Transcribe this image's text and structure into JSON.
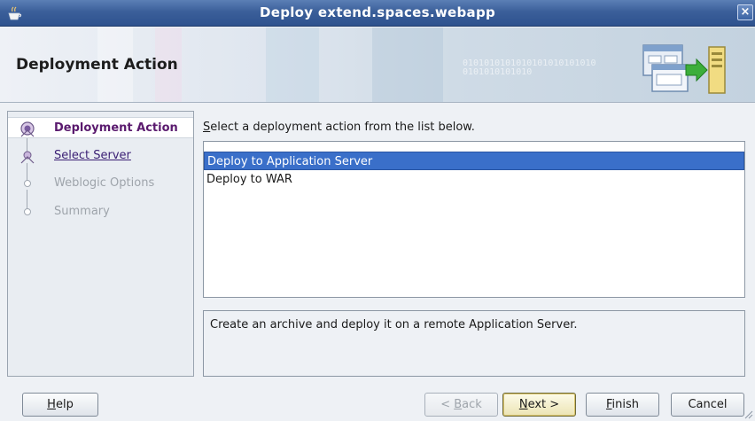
{
  "window": {
    "title": "Deploy extend.spaces.webapp",
    "close_symbol": "×",
    "app_icon": "java-cup-icon"
  },
  "header": {
    "title": "Deployment Action",
    "binary_text": "0101010101010101010101010\n0101010101010",
    "graphic_icon": "deploy-to-server-icon"
  },
  "nav": {
    "items": [
      {
        "label": "Deployment Action",
        "state": "active"
      },
      {
        "label": "Select Server",
        "state": "link"
      },
      {
        "label": "Weblogic Options",
        "state": "disabled"
      },
      {
        "label": "Summary",
        "state": "disabled"
      }
    ]
  },
  "content": {
    "instruction_mnemonic": "S",
    "instruction_rest": "elect a deployment action from the list below.",
    "actions": [
      {
        "label": "Deploy to Application Server",
        "selected": true
      },
      {
        "label": "Deploy to WAR",
        "selected": false
      }
    ],
    "description": "Create an archive and deploy it on a remote Application Server."
  },
  "buttons": {
    "help_mnemonic": "H",
    "help_rest": "elp",
    "back_prefix": "< ",
    "back_mnemonic": "B",
    "back_rest": "ack",
    "next_mnemonic": "N",
    "next_rest": "ext >",
    "finish_mnemonic": "F",
    "finish_rest": "inish",
    "cancel": "Cancel"
  },
  "colors": {
    "titlebar": "#3b5f9a",
    "selection": "#3a6fc9",
    "active_nav_text": "#5a1a6e"
  }
}
